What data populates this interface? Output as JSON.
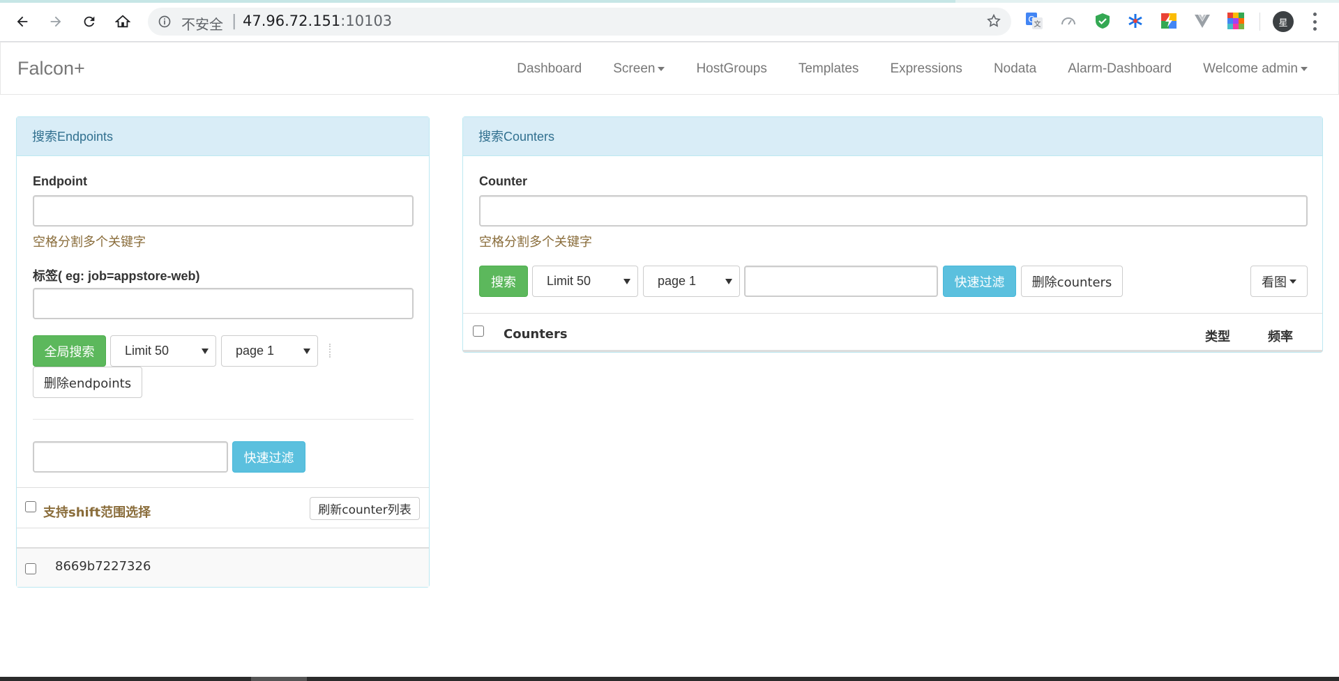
{
  "browser": {
    "insecure_label": "不安全",
    "separator": "|",
    "url_host": "47.96.72.151",
    "url_port": ":10103",
    "profile_initial": "星"
  },
  "app": {
    "brand": "Falcon+",
    "nav": [
      {
        "label": "Dashboard",
        "dropdown": false
      },
      {
        "label": "Screen",
        "dropdown": true
      },
      {
        "label": "HostGroups",
        "dropdown": false
      },
      {
        "label": "Templates",
        "dropdown": false
      },
      {
        "label": "Expressions",
        "dropdown": false
      },
      {
        "label": "Nodata",
        "dropdown": false
      },
      {
        "label": "Alarm-Dashboard",
        "dropdown": false
      },
      {
        "label": "Welcome admin",
        "dropdown": true
      }
    ]
  },
  "endpoints_panel": {
    "title": "搜索Endpoints",
    "endpoint_label": "Endpoint",
    "endpoint_value": "",
    "endpoint_help": "空格分割多个关键字",
    "tag_label": "标签( eg: job=appstore-web)",
    "tag_value": "",
    "search_all_button": "全局搜索",
    "limit_select": "Limit 50",
    "page_select": "page 1",
    "delete_button": "删除endpoints",
    "filter_value": "",
    "filter_button": "快速过滤",
    "shift_select_label": "支持shift范围选择",
    "refresh_button": "刷新counter列表",
    "rows": [
      {
        "name": "8669b7227326",
        "checked": false
      }
    ]
  },
  "counters_panel": {
    "title": "搜索Counters",
    "counter_label": "Counter",
    "counter_value": "",
    "counter_help": "空格分割多个关键字",
    "search_button": "搜索",
    "limit_select": "Limit 50",
    "page_select": "page 1",
    "filter_value": "",
    "filter_button": "快速过滤",
    "delete_button": "删除counters",
    "view_button": "看图",
    "table_headers": {
      "counters": "Counters",
      "type": "类型",
      "freq": "频率"
    }
  },
  "colors": {
    "panel_heading_bg": "#d9edf7",
    "panel_border": "#bce8f1",
    "panel_heading_text": "#31708f",
    "success": "#5cb85c",
    "info": "#5bc0de",
    "help_text": "#8a6d3b"
  }
}
